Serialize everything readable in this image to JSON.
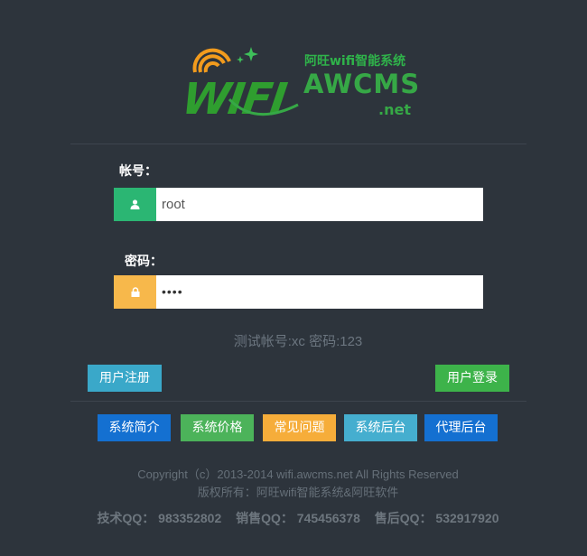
{
  "logo": {
    "wifi_text": "WIFI",
    "tagline": "阿旺wifi智能系统",
    "brand": "AWCMS",
    "domain": ".net"
  },
  "form": {
    "username_label": "帐号：",
    "username_value": "root",
    "password_label": "密码：",
    "password_value": "••••",
    "test_account_hint": "测试帐号:xc  密码:123"
  },
  "buttons": {
    "register": "用户注册",
    "login": "用户登录"
  },
  "nav": [
    {
      "label": "系统简介"
    },
    {
      "label": "系统价格"
    },
    {
      "label": "常见问题"
    },
    {
      "label": "系统后台"
    },
    {
      "label": "代理后台"
    }
  ],
  "footer": {
    "copyright": "Copyright（c）2013-2014 wifi.awcms.net All Rights Reserved",
    "owner": "版权所有：阿旺wifi智能系统&阿旺软件",
    "support_qq": "技术QQ： 983352802",
    "sales_qq": "销售QQ： 745456378",
    "after_sales_qq": "售后QQ： 532917920"
  },
  "colors": {
    "background": "#2d343c",
    "user_addon": "#2bb673",
    "pass_addon": "#f7b84b",
    "register": "#3aa8c9",
    "login": "#3db34a"
  },
  "icons": {
    "user": "user-icon",
    "lock": "lock-icon"
  }
}
